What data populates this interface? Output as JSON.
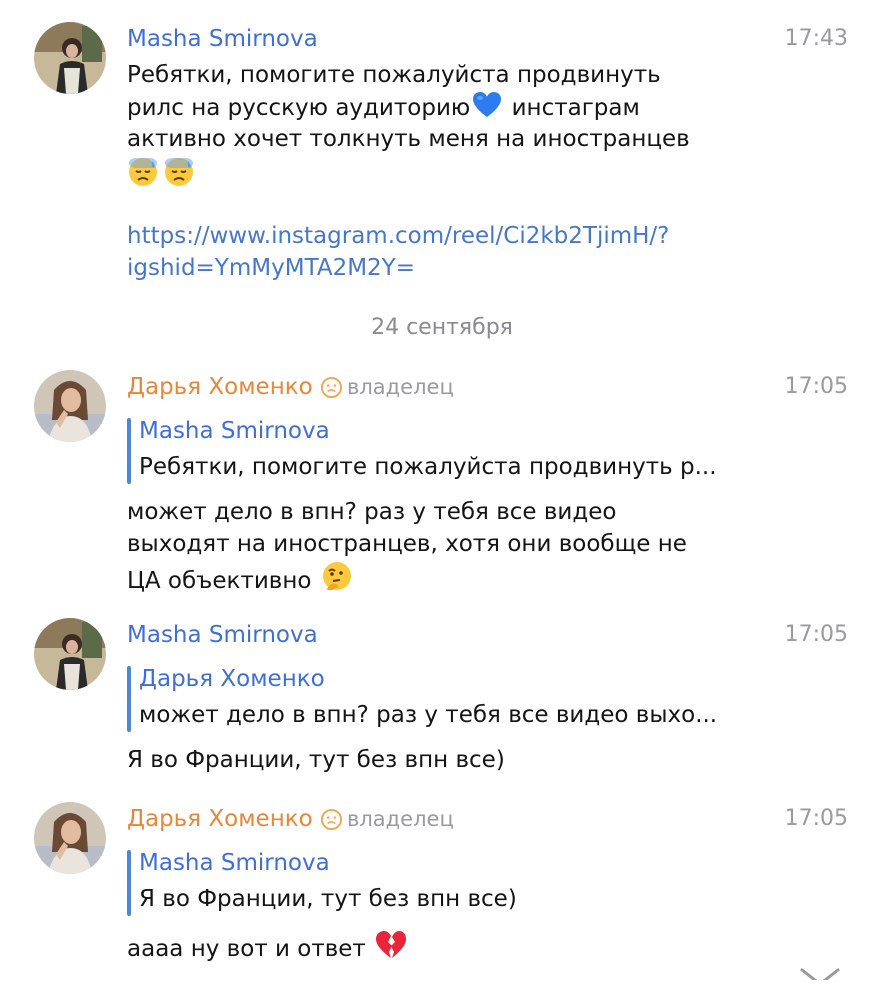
{
  "messages": [
    {
      "author": "Masha Smirnova",
      "time": "17:43",
      "lines": [
        "Ребятки, помогите пожалуйста продвинуть",
        "рилс на русскую аудиторию",
        "инстаграм",
        "активно хочет толкнуть меня на иностранцев"
      ],
      "emoji": [
        "blue-heart",
        "downcast-sweat",
        "downcast-sweat"
      ],
      "link_lines": [
        "https://www.instagram.com/reel/Ci2kb2TjimH/?",
        "igshid=YmMyMTA2M2Y="
      ]
    },
    {
      "author": "Дарья Хоменко",
      "role": "владелец",
      "time": "17:05",
      "reply_author": "Masha Smirnova",
      "reply_text": "Ребятки, помогите пожалуйста продвинуть р...",
      "lines": [
        "может дело в впн? раз у тебя все видео",
        "выходят на иностранцев, хотя они вообще не",
        "ЦА объективно"
      ],
      "emoji": [
        "thinking"
      ]
    },
    {
      "author": "Masha Smirnova",
      "time": "17:05",
      "reply_author": "Дарья Хоменко",
      "reply_text": "может дело в впн? раз у тебя все видео выхо...",
      "lines": [
        "Я во Франции, тут без впн все)"
      ]
    },
    {
      "author": "Дарья Хоменко",
      "role": "владелец",
      "time": "17:05",
      "reply_author": "Masha Smirnova",
      "reply_text": "Я во Франции, тут без впн все)",
      "lines": [
        "аааа ну вот и ответ"
      ],
      "emoji": [
        "broken-heart"
      ]
    }
  ],
  "date_separator": "24 сентября",
  "icons": {
    "role_icon": "face-icon",
    "scroll_down": "chevron-down-icon"
  },
  "colors": {
    "masha_name": "#3f6fd6",
    "darya_name": "#e8873a",
    "link": "#4677c9",
    "reply_bar": "#4f87d8",
    "meta_gray": "#9a9a9f"
  }
}
